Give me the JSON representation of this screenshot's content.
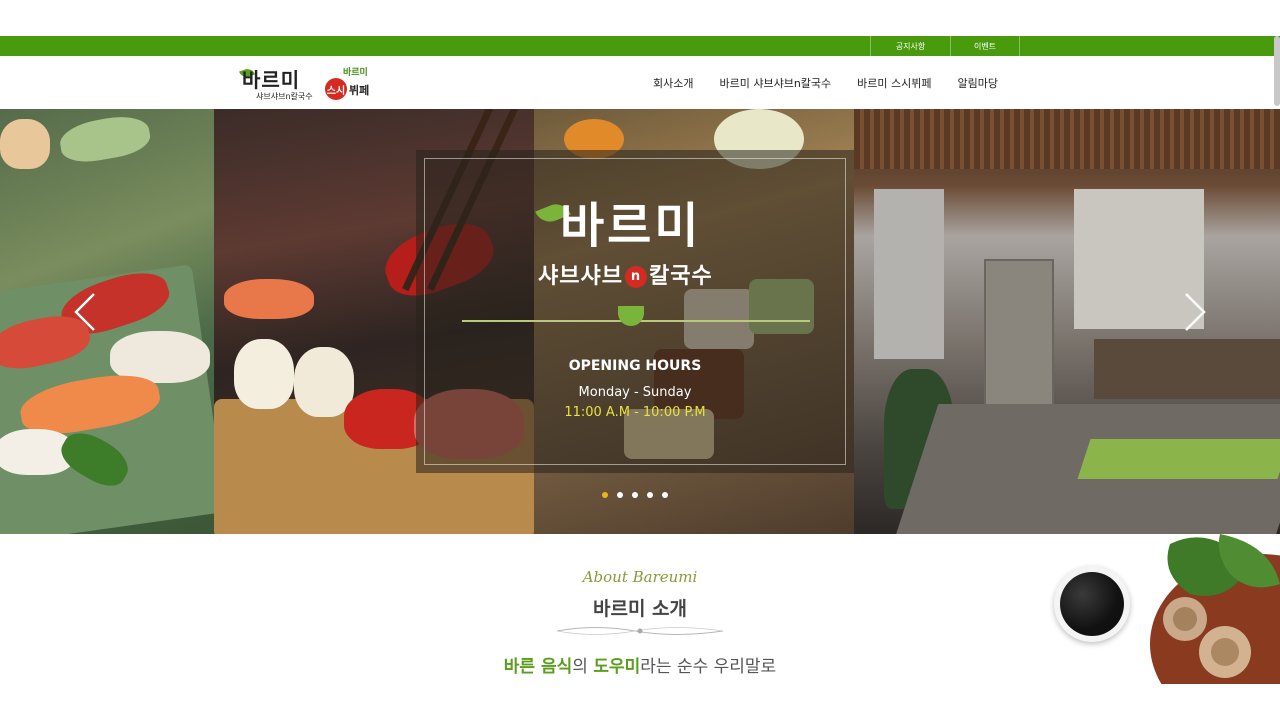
{
  "topbar": {
    "links": [
      "공지사항",
      "이벤트"
    ]
  },
  "logos": {
    "primary_main": "바르미",
    "primary_sub": "샤브샤브n칼국수",
    "secondary_circle": "스시",
    "secondary_mini": "바르미",
    "secondary_main": "뷔페"
  },
  "nav": {
    "items": [
      "회사소개",
      "바르미 샤브샤브n칼국수",
      "바르미 스시뷔페",
      "알림마당"
    ]
  },
  "hero": {
    "brand_main": "바르미",
    "brand_sub_left": "샤브샤브",
    "brand_sub_n": "n",
    "brand_sub_right": "칼국수",
    "hours_title": "OPENING HOURS",
    "hours_days": "Monday - Sunday",
    "hours_time": "11:00 A.M - 10:00 P.M",
    "slides_total": 5,
    "active_slide": 1
  },
  "about": {
    "script_title": "About Bareumi",
    "title": "바르미 소개",
    "tagline_highlight_1": "바른 음식",
    "tagline_mid": "의 ",
    "tagline_highlight_2": "도우미",
    "tagline_rest": "라는 순수 우리말로"
  },
  "colors": {
    "brand_green": "#4a9a0e",
    "accent_yellow": "#e8e23a",
    "active_dot": "#e7b520",
    "logo_red": "#d52a22"
  },
  "icons": {
    "prev": "chevron-left-icon",
    "next": "chevron-right-icon"
  }
}
